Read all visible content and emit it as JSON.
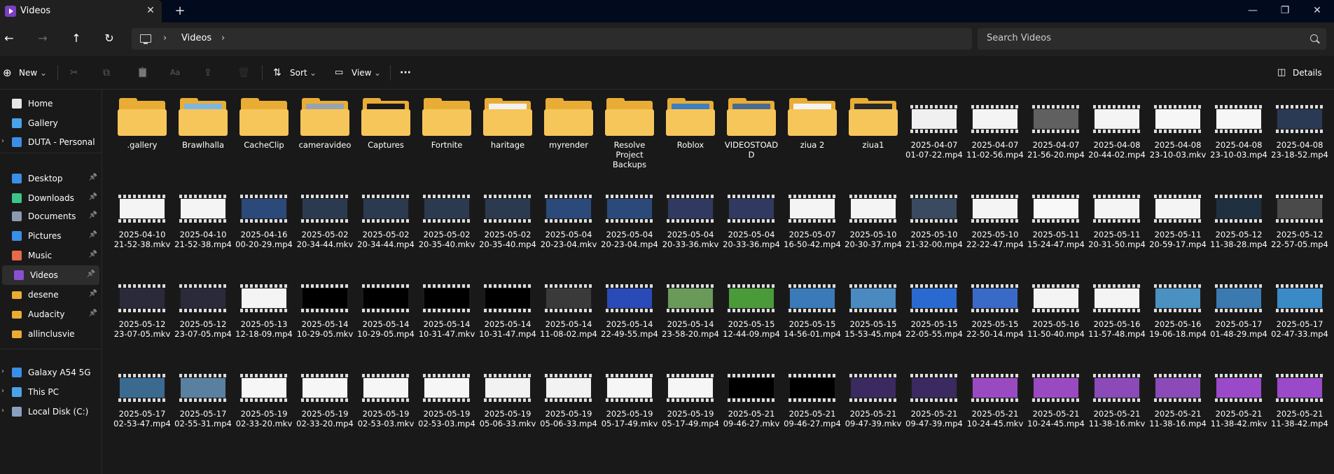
{
  "window": {
    "tab_title": "Videos",
    "tab_close": "✕",
    "new_tab": "+",
    "minimize": "—",
    "maximize": "❐",
    "close": "✕"
  },
  "addressbar": {
    "back": "←",
    "forward": "→",
    "up": "↑",
    "refresh": "↻",
    "sep1": "›",
    "crumb": "Videos",
    "sep2": "›",
    "search_placeholder": "Search Videos"
  },
  "toolbar": {
    "new_label": "New",
    "cut": "✂",
    "copy": "⧉",
    "paste": "📋",
    "rename": "Aa",
    "share": "⇪",
    "delete": "🗑",
    "sort_label": "Sort",
    "view_label": "View",
    "more": "···",
    "details_label": "Details",
    "chevron": "⌄"
  },
  "sidebar": {
    "items": [
      {
        "label": "Home",
        "icon": "home-icon",
        "color": "#e8e8e8",
        "pinned": false
      },
      {
        "label": "Gallery",
        "icon": "gallery-icon",
        "color": "#4aa3e8",
        "pinned": false
      },
      {
        "label": "DUTA - Personal",
        "icon": "onedrive-icon",
        "color": "#3b8ee8",
        "pinned": false,
        "expandable": true
      },
      {
        "label": "Desktop",
        "icon": "desktop-icon",
        "color": "#3b8ee8",
        "pinned": true
      },
      {
        "label": "Downloads",
        "icon": "downloads-icon",
        "color": "#3cc48a",
        "pinned": true
      },
      {
        "label": "Documents",
        "icon": "documents-icon",
        "color": "#8a9ab0",
        "pinned": true
      },
      {
        "label": "Pictures",
        "icon": "pictures-icon",
        "color": "#3b8ee8",
        "pinned": true
      },
      {
        "label": "Music",
        "icon": "music-icon",
        "color": "#e86a4a",
        "pinned": true
      },
      {
        "label": "Videos",
        "icon": "videos-icon",
        "color": "#8a4fd0",
        "pinned": true,
        "selected": true
      },
      {
        "label": "desene",
        "icon": "folder-icon",
        "color": "#e9ad35",
        "pinned": true
      },
      {
        "label": "Audacity",
        "icon": "folder-icon",
        "color": "#e9ad35",
        "pinned": true
      },
      {
        "label": "allinclusvie",
        "icon": "folder-icon",
        "color": "#e9ad35",
        "pinned": false
      },
      {
        "label": "Galaxy A54 5G",
        "icon": "phone-icon",
        "color": "#3b8ee8",
        "pinned": false,
        "expandable": true
      },
      {
        "label": "This PC",
        "icon": "this-pc-icon",
        "color": "#4aa3e8",
        "pinned": false,
        "expandable": true
      },
      {
        "label": "Local Disk (C:)",
        "icon": "disk-icon",
        "color": "#8aa0c0",
        "pinned": false,
        "expandable": true
      }
    ],
    "pin_glyph": "📌",
    "expand_glyph": "›"
  },
  "files": [
    {
      "name": ".gallery",
      "kind": "folder",
      "preview": ""
    },
    {
      "name": "Brawlhalla",
      "kind": "folder",
      "preview": "#7fb6e0"
    },
    {
      "name": "CacheClip",
      "kind": "folder",
      "preview": ""
    },
    {
      "name": "cameravideo",
      "kind": "folder",
      "preview": "#9aa3ad"
    },
    {
      "name": "Captures",
      "kind": "folder",
      "preview": "#1a1a1a"
    },
    {
      "name": "Fortnite",
      "kind": "folder",
      "preview": ""
    },
    {
      "name": "haritage",
      "kind": "folder",
      "preview": "#f2f2f2"
    },
    {
      "name": "myrender",
      "kind": "folder",
      "preview": ""
    },
    {
      "name": "Resolve Project Backups",
      "kind": "folder",
      "preview": ""
    },
    {
      "name": "Roblox",
      "kind": "folder",
      "preview": "#3d7fc0"
    },
    {
      "name": "VIDEOSTOADD",
      "kind": "folder",
      "preview": "#4a6a90"
    },
    {
      "name": "ziua 2",
      "kind": "folder",
      "preview": "#f4f4f4"
    },
    {
      "name": "ziua1",
      "kind": "folder",
      "preview": "#2a2a2a"
    },
    {
      "name": "2025-04-07 01-07-22.mp4",
      "kind": "video",
      "frame": "#f0f0f0"
    },
    {
      "name": "2025-04-07 11-02-56.mp4",
      "kind": "video",
      "frame": "#f4f4f4"
    },
    {
      "name": "2025-04-07 21-56-20.mp4",
      "kind": "video",
      "frame": "#606060"
    },
    {
      "name": "2025-04-08 20-44-02.mp4",
      "kind": "video",
      "frame": "#f4f4f4"
    },
    {
      "name": "2025-04-08 23-10-03.mkv",
      "kind": "video",
      "frame": "#f6f6f6"
    },
    {
      "name": "2025-04-08 23-10-03.mp4",
      "kind": "video",
      "frame": "#f6f6f6"
    },
    {
      "name": "2025-04-08 23-18-52.mp4",
      "kind": "video",
      "frame": "#2a3a55"
    },
    {
      "name": "2025-04-10 21-52-38.mkv",
      "kind": "video",
      "frame": "#f4f4f4"
    },
    {
      "name": "2025-04-10 21-52-38.mp4",
      "kind": "video",
      "frame": "#f4f4f4"
    },
    {
      "name": "2025-04-16 00-20-29.mp4",
      "kind": "video",
      "frame": "#2b4a7a"
    },
    {
      "name": "2025-05-02 20-34-44.mkv",
      "kind": "video",
      "frame": "#2c3a4f"
    },
    {
      "name": "2025-05-02 20-34-44.mp4",
      "kind": "video",
      "frame": "#2c3a4f"
    },
    {
      "name": "2025-05-02 20-35-40.mkv",
      "kind": "video",
      "frame": "#2c3a4f"
    },
    {
      "name": "2025-05-02 20-35-40.mp4",
      "kind": "video",
      "frame": "#2c3a4f"
    },
    {
      "name": "2025-05-04 20-23-04.mkv",
      "kind": "video",
      "frame": "#2b4a7a"
    },
    {
      "name": "2025-05-04 20-23-04.mp4",
      "kind": "video",
      "frame": "#2b4a7a"
    },
    {
      "name": "2025-05-04 20-33-36.mkv",
      "kind": "video",
      "frame": "#303a60"
    },
    {
      "name": "2025-05-04 20-33-36.mp4",
      "kind": "video",
      "frame": "#303a60"
    },
    {
      "name": "2025-05-07 16-50-42.mp4",
      "kind": "video",
      "frame": "#f4f4f4"
    },
    {
      "name": "2025-05-10 20-30-37.mp4",
      "kind": "video",
      "frame": "#f4f4f4"
    },
    {
      "name": "2025-05-10 21-32-00.mp4",
      "kind": "video",
      "frame": "#3a4a60"
    },
    {
      "name": "2025-05-10 22-22-47.mp4",
      "kind": "video",
      "frame": "#f4f4f4"
    },
    {
      "name": "2025-05-11 15-24-47.mp4",
      "kind": "video",
      "frame": "#f8f8f8"
    },
    {
      "name": "2025-05-11 20-31-50.mp4",
      "kind": "video",
      "frame": "#f4f4f4"
    },
    {
      "name": "2025-05-11 20-59-17.mp4",
      "kind": "video",
      "frame": "#f4f4f4"
    },
    {
      "name": "2025-05-12 11-38-28.mp4",
      "kind": "video",
      "frame": "#1f3040"
    },
    {
      "name": "2025-05-12 22-57-05.mp4",
      "kind": "video",
      "frame": "#4a4a4a"
    },
    {
      "name": "2025-05-12 23-07-05.mkv",
      "kind": "video",
      "frame": "#2a2a3a"
    },
    {
      "name": "2025-05-12 23-07-05.mp4",
      "kind": "video",
      "frame": "#2a2a3a"
    },
    {
      "name": "2025-05-13 12-18-09.mp4",
      "kind": "video",
      "frame": "#f4f4f4"
    },
    {
      "name": "2025-05-14 10-29-05.mkv",
      "kind": "video",
      "frame": "#000000"
    },
    {
      "name": "2025-05-14 10-29-05.mp4",
      "kind": "video",
      "frame": "#000000"
    },
    {
      "name": "2025-05-14 10-31-47.mkv",
      "kind": "video",
      "frame": "#000000"
    },
    {
      "name": "2025-05-14 10-31-47.mp4",
      "kind": "video",
      "frame": "#000000"
    },
    {
      "name": "2025-05-14 11-08-02.mp4",
      "kind": "video",
      "frame": "#3a3a3a"
    },
    {
      "name": "2025-05-14 22-49-55.mp4",
      "kind": "video",
      "frame": "#2a4ab8"
    },
    {
      "name": "2025-05-14 23-58-20.mp4",
      "kind": "video",
      "frame": "#6a9a5a"
    },
    {
      "name": "2025-05-15 12-44-09.mp4",
      "kind": "video",
      "frame": "#4a9a3a"
    },
    {
      "name": "2025-05-15 14-56-01.mp4",
      "kind": "video",
      "frame": "#3a7ab8"
    },
    {
      "name": "2025-05-15 15-53-45.mp4",
      "kind": "video",
      "frame": "#4a8ac0"
    },
    {
      "name": "2025-05-15 22-05-55.mp4",
      "kind": "video",
      "frame": "#2a6ad0"
    },
    {
      "name": "2025-05-15 22-50-14.mp4",
      "kind": "video",
      "frame": "#3a6ac8"
    },
    {
      "name": "2025-05-16 11-50-40.mp4",
      "kind": "video",
      "frame": "#f4f4f4"
    },
    {
      "name": "2025-05-16 11-57-48.mp4",
      "kind": "video",
      "frame": "#f4f4f4"
    },
    {
      "name": "2025-05-16 19-06-18.mp4",
      "kind": "video",
      "frame": "#4a90c0"
    },
    {
      "name": "2025-05-17 01-48-29.mp4",
      "kind": "video",
      "frame": "#3a7ab0"
    },
    {
      "name": "2025-05-17 02-47-33.mp4",
      "kind": "video",
      "frame": "#3a8ac8"
    },
    {
      "name": "2025-05-17 02-53-47.mp4",
      "kind": "video",
      "frame": "#3a6a90"
    },
    {
      "name": "2025-05-17 02-55-31.mp4",
      "kind": "video",
      "frame": "#5a80a0"
    },
    {
      "name": "2025-05-19 02-33-20.mkv",
      "kind": "video",
      "frame": "#f6f6f6"
    },
    {
      "name": "2025-05-19 02-33-20.mp4",
      "kind": "video",
      "frame": "#f6f6f6"
    },
    {
      "name": "2025-05-19 02-53-03.mkv",
      "kind": "video",
      "frame": "#f6f6f6"
    },
    {
      "name": "2025-05-19 02-53-03.mp4",
      "kind": "video",
      "frame": "#f6f6f6"
    },
    {
      "name": "2025-05-19 05-06-33.mkv",
      "kind": "video",
      "frame": "#f2f2f2"
    },
    {
      "name": "2025-05-19 05-06-33.mp4",
      "kind": "video",
      "frame": "#f2f2f2"
    },
    {
      "name": "2025-05-19 05-17-49.mkv",
      "kind": "video",
      "frame": "#f6f6f6"
    },
    {
      "name": "2025-05-19 05-17-49.mp4",
      "kind": "video",
      "frame": "#f6f6f6"
    },
    {
      "name": "2025-05-21 09-46-27.mkv",
      "kind": "video",
      "frame": "#000000"
    },
    {
      "name": "2025-05-21 09-46-27.mp4",
      "kind": "video",
      "frame": "#000000"
    },
    {
      "name": "2025-05-21 09-47-39.mkv",
      "kind": "video",
      "frame": "#3a2a60"
    },
    {
      "name": "2025-05-21 09-47-39.mp4",
      "kind": "video",
      "frame": "#3a2a60"
    },
    {
      "name": "2025-05-21 10-24-45.mkv",
      "kind": "video",
      "frame": "#9a4ac0"
    },
    {
      "name": "2025-05-21 10-24-45.mp4",
      "kind": "video",
      "frame": "#9a4ac0"
    },
    {
      "name": "2025-05-21 11-38-16.mkv",
      "kind": "video",
      "frame": "#8a4ab8"
    },
    {
      "name": "2025-05-21 11-38-16.mp4",
      "kind": "video",
      "frame": "#8a4ab8"
    },
    {
      "name": "2025-05-21 11-38-42.mkv",
      "kind": "video",
      "frame": "#9a4ac8"
    },
    {
      "name": "2025-05-21 11-38-42.mp4",
      "kind": "video",
      "frame": "#9a4ac8"
    }
  ]
}
